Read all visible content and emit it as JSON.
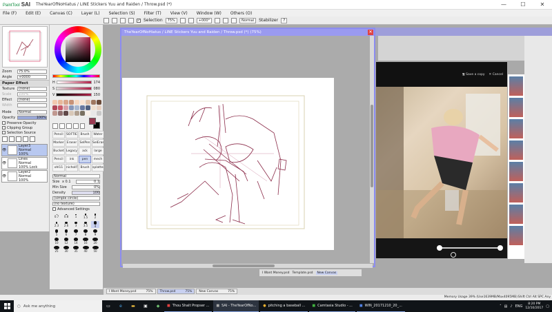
{
  "window": {
    "app_name": "SAI",
    "app_vendor": "PaintTool",
    "title": "TheYearOfNoHiatus / LINE Stickers Yuu and Raiden / Throw.psd (*)",
    "controls": [
      "—",
      "☐",
      "✕"
    ]
  },
  "menu": [
    "File (F)",
    "Edit (E)",
    "Canvas (C)",
    "Layer (L)",
    "Selection (S)",
    "Filter (T)",
    "View (V)",
    "Window (W)",
    "Others (O)"
  ],
  "toolbar": {
    "selection_label": "Selection",
    "zoom_value": "75%",
    "rotation_value": "+000°",
    "normal_label": "Normal",
    "stabilizer_label": "Stabilizer",
    "stabilizer_value": "7"
  },
  "navigator": {
    "zoom_label": "Zoom",
    "zoom_value": "75.0%",
    "angle_label": "Angle",
    "angle_value": "+0000"
  },
  "paper_effect": {
    "header": "Paper Effect",
    "texture_label": "Texture",
    "texture_value": "(none)",
    "scale_label": "Scale",
    "scale_value": "100%",
    "effect_label": "Effect",
    "effect_value": "(none)",
    "width_label": "Width"
  },
  "blend": {
    "mode_label": "Mode",
    "mode_value": "Normal",
    "opacity_label": "Opacity",
    "opacity_value": "100%"
  },
  "layer_options": [
    "Preserve Opacity",
    "Clipping Group",
    "Selection Source"
  ],
  "layers": [
    {
      "name": "Layer3",
      "mode": "Normal",
      "opacity": "100%",
      "selected": true
    },
    {
      "name": "Lines",
      "mode": "Normal",
      "opacity": "100% Lock",
      "selected": false
    },
    {
      "name": "Layer2",
      "mode": "Normal",
      "opacity": "100%",
      "selected": false
    }
  ],
  "color": {
    "h_label": "H",
    "h_value": "174",
    "s_label": "S",
    "s_value": "080",
    "v_label": "V",
    "v_value": "150",
    "current": "#9a3a52",
    "secondary": "#000000",
    "swatches": [
      "#f2c9b0",
      "#e8b89a",
      "#d9a58a",
      "#c79378",
      "#f7d8c0",
      "#fbe3d2",
      "#e0c0a8",
      "#a07860",
      "#6a4a38",
      "#b04858",
      "#c85868",
      "#d8a0a8",
      "#8898b8",
      "#a8b8d0",
      "#6878a0",
      "#506080",
      "#f0e0d0",
      "#e8d0c0",
      "#c09890",
      "#907070",
      "#604848",
      "#d8c8b8",
      "#b0a090",
      "#787060",
      "#f8f0e8",
      "#e8e8e8",
      "#c8c8c8"
    ]
  },
  "tools": [
    {
      "label": "Pencil",
      "sel": false
    },
    {
      "label": "SOFTIE",
      "sel": false
    },
    {
      "label": "Brush",
      "sel": false
    },
    {
      "label": "Water",
      "sel": false
    },
    {
      "label": "Marker",
      "sel": false
    },
    {
      "label": "Eraser",
      "sel": false
    },
    {
      "label": "SelPen",
      "sel": false
    },
    {
      "label": "SelEras",
      "sel": false
    },
    {
      "label": "Bucket",
      "sel": false
    },
    {
      "label": "Legacy Pen",
      "sel": false
    },
    {
      "label": "ack line",
      "sel": false
    },
    {
      "label": "large pe",
      "sel": false
    },
    {
      "label": "Pencil",
      "sel": false
    },
    {
      "label": "ink",
      "sel": false
    },
    {
      "label": "pen",
      "sel": true
    },
    {
      "label": "mech pe",
      "sel": false
    },
    {
      "label": "ohl11",
      "sel": false
    },
    {
      "label": "nicholl5",
      "sel": false
    },
    {
      "label": "Brush",
      "sel": false
    },
    {
      "label": "splatter",
      "sel": false
    }
  ],
  "brush": {
    "mode_value": "Normal",
    "size_label": "Size",
    "size_mult": "x 0.1",
    "size_value": "0.1",
    "min_size_label": "Min Size",
    "min_size_value": "0%",
    "density_label": "Density",
    "density_value": "100",
    "shape_value": "(simple circle)",
    "texture_value": "(no texture)",
    "advanced_label": "Advanced Settings",
    "sizes": [
      "0.7",
      "0.8",
      "1",
      "1.5",
      "2",
      "2.3",
      "2.6",
      "3",
      "3.5",
      "4",
      "5",
      "6",
      "7",
      "8",
      "9",
      "10",
      "12",
      "14",
      "16",
      "20",
      "25",
      "30",
      "35",
      "40",
      "50"
    ]
  },
  "canvas_window": {
    "title": "TheYearOfNoHiatus / LINE Stickers Yuu and Raiden / Throw.psd (*) (75%)"
  },
  "photo_viewer": {
    "save_label": "Save a copy",
    "cancel_label": "Cancel"
  },
  "doc_tabs": [
    {
      "name": "I Want Money.psd",
      "zoom": "75%",
      "selected": false
    },
    {
      "name": "Throw.psd",
      "zoom": "75%",
      "selected": true
    },
    {
      "name": "New Canvas",
      "zoom": "75%",
      "selected": false
    }
  ],
  "back_tabs": [
    "I Want Money.psd",
    "Template.psd",
    "New Canvas"
  ],
  "status": {
    "memory": "Memory Usage 39% (Use1639MB/Max4095MB)",
    "indicators": "Shift Ctrl Alt SPC Any"
  },
  "taskbar": {
    "search_placeholder": "Ask me anything",
    "apps": [
      {
        "label": "Thou Shalt Propser ...",
        "active": false
      },
      {
        "label": "SAI - TheYearOfNo...",
        "active": true
      },
      {
        "label": "pitching a baseball ...",
        "active": false
      },
      {
        "label": "Camtasia Studio - ...",
        "active": false
      },
      {
        "label": "WIN_20171210_20_...",
        "active": false
      }
    ],
    "language": "ENG",
    "time": "8:20 PM",
    "date": "12/10/2017"
  }
}
